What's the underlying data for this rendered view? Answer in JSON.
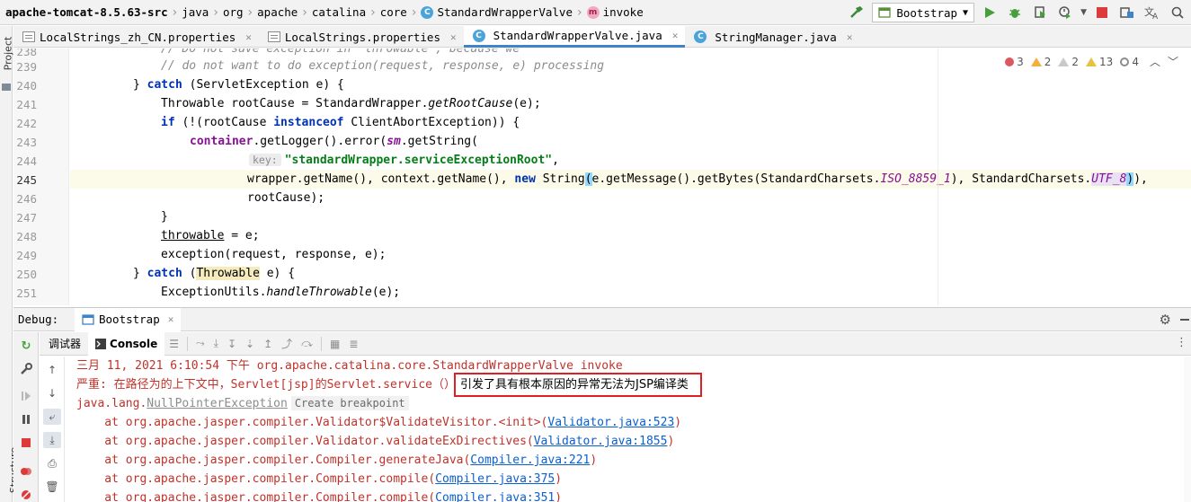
{
  "navbar": {
    "crumbs": [
      "apache-tomcat-8.5.63-src",
      "java",
      "org",
      "apache",
      "catalina",
      "core",
      "StandardWrapperValve",
      "invoke"
    ],
    "run_config": "Bootstrap",
    "icons": [
      "build-hammer-icon",
      "run-icon",
      "debug-icon",
      "coverage-icon",
      "profile-icon",
      "stop-icon",
      "project-structure-icon",
      "translate-icon"
    ]
  },
  "left_strip": {
    "project_label": "Project",
    "structure_label": "Structure"
  },
  "tabs": [
    {
      "label": "LocalStrings_zh_CN.properties",
      "icon": "properties-file-icon",
      "active": false
    },
    {
      "label": "LocalStrings.properties",
      "icon": "properties-file-icon",
      "active": false
    },
    {
      "label": "StandardWrapperValve.java",
      "icon": "class-icon",
      "active": true
    },
    {
      "label": "StringManager.java",
      "icon": "class-icon",
      "active": false
    }
  ],
  "inspections": {
    "errors": "3",
    "warnings": "2",
    "weak_warnings": "2",
    "typos": "13",
    "other": "4"
  },
  "editor": {
    "line_numbers": [
      "238",
      "239",
      "240",
      "241",
      "242",
      "243",
      "244",
      "245",
      "246",
      "247",
      "248",
      "249",
      "250",
      "251"
    ],
    "current_line": "245"
  },
  "code_text": {
    "l238": "// Do not save exception in 'throwable', because we",
    "l239": "// do not want to do exception(request, response, e) processing",
    "l240_kw": "catch",
    "l240_rest": " (ServletException e) {",
    "l241_a": "Throwable rootCause = StandardWrapper.",
    "l241_b": "getRootCause",
    "l241_c": "(e);",
    "l242_kw1": "if",
    "l242_a": " (!(rootCause ",
    "l242_kw2": "instanceof",
    "l242_b": " ClientAbortException)) {",
    "l243_a": "container",
    "l243_b": ".getLogger().error(",
    "l243_c": "sm",
    "l243_d": ".getString(",
    "l244_hint": "key:",
    "l244_str": "\"standardWrapper.serviceExceptionRoot\"",
    "l244_end": ",",
    "l245_a": "wrapper.getName(), context.getName(), ",
    "l245_kw": "new",
    "l245_b": " String",
    "l245_c": "(",
    "l245_d": "e.getMessage().getBytes(StandardCharsets.",
    "l245_e": "ISO_8859_1",
    "l245_f": "), StandardCharsets.",
    "l245_g": "UTF_8",
    "l245_h": ")",
    "l245_i": "),",
    "l246": "rootCause);",
    "l247": "}",
    "l248_a": "throwable",
    "l248_b": " = e;",
    "l249": "exception(request, response, e);",
    "l250_a": "} ",
    "l250_kw": "catch",
    "l250_b": " (",
    "l250_c": "Throwable",
    "l250_d": " e) {",
    "l251_a": "ExceptionUtils.",
    "l251_b": "handleThrowable",
    "l251_c": "(e);"
  },
  "debug": {
    "label": "Debug:",
    "session": "Bootstrap",
    "subtabs": [
      "调试器",
      "Console"
    ]
  },
  "console": {
    "line1": "三月 11, 2021 6:10:54 下午 org.apache.catalina.core.StandardWrapperValve invoke",
    "line2": "严重: 在路径为的上下文中，Servlet[jsp]的Servlet.service（）",
    "callout": "引发了具有根本原因的异常无法为JSP编译类",
    "line3_a": "java.lang.",
    "line3_b": "NullPointerException",
    "create_breakpoint": "Create breakpoint",
    "frames": [
      {
        "text": "    at org.apache.jasper.compiler.Validator$ValidateVisitor.<init>(",
        "link": "Validator.java:523",
        "end": ")"
      },
      {
        "text": "    at org.apache.jasper.compiler.Validator.validateExDirectives(",
        "link": "Validator.java:1855",
        "end": ")"
      },
      {
        "text": "    at org.apache.jasper.compiler.Compiler.generateJava(",
        "link": "Compiler.java:221",
        "end": ")"
      },
      {
        "text": "    at org.apache.jasper.compiler.Compiler.compile(",
        "link": "Compiler.java:375",
        "end": ")"
      },
      {
        "text": "    at org.apache.jasper.compiler.Compiler.compile(",
        "link": "Compiler.java:351",
        "end": ")"
      }
    ]
  },
  "colors": {
    "accent": "#4083c9",
    "error_red": "#c0322b",
    "link_blue": "#0b5fd1",
    "callout_border": "#e02020"
  }
}
